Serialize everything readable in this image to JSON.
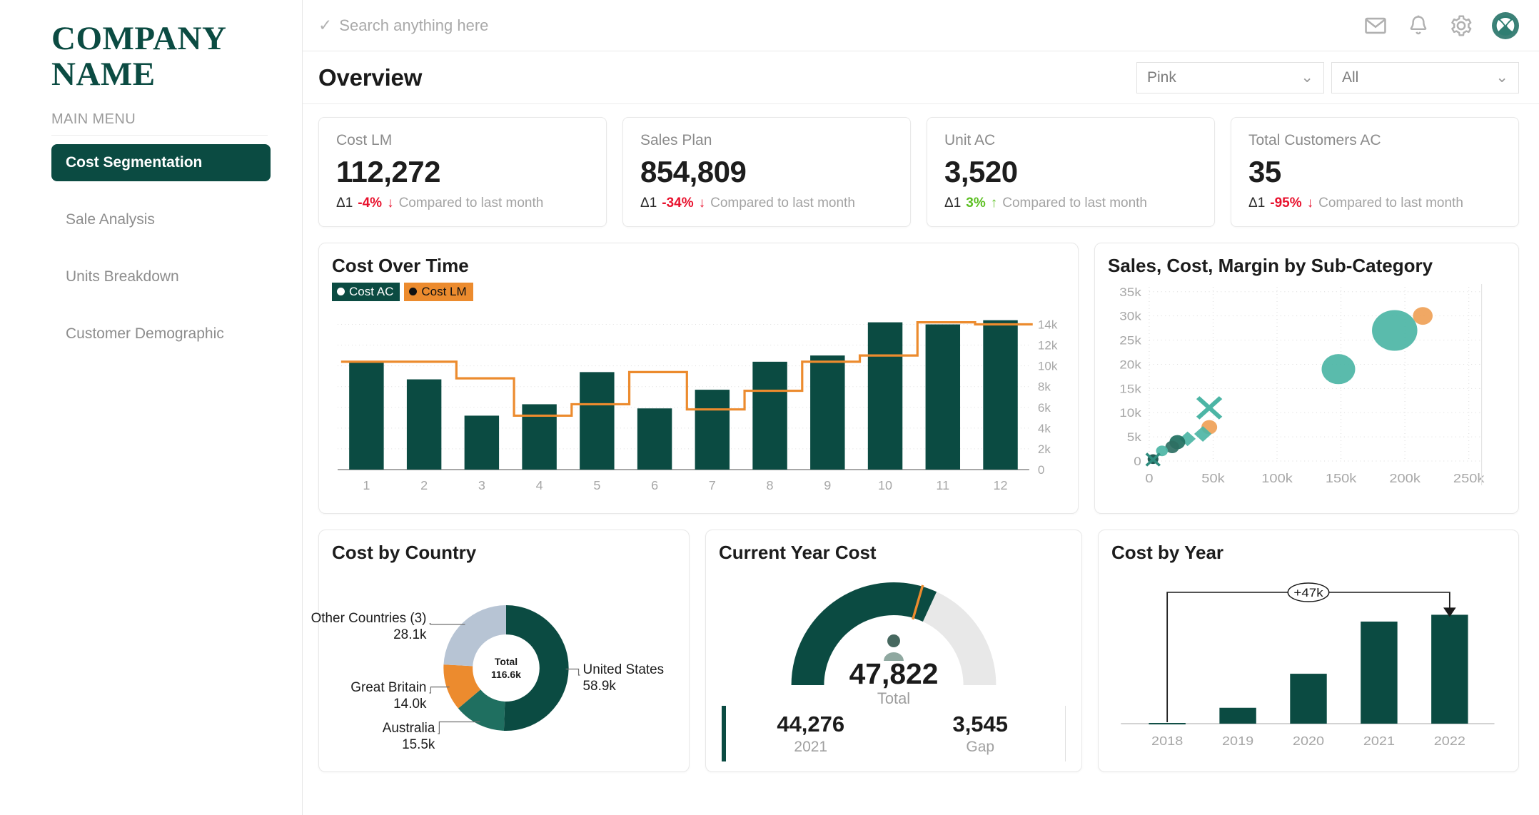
{
  "brand": {
    "name": "COMPANY\nNAME"
  },
  "sidebar": {
    "section_label": "MAIN MENU",
    "items": [
      {
        "label": "Cost Segmentation"
      },
      {
        "label": "Sale Analysis"
      },
      {
        "label": "Units Breakdown"
      },
      {
        "label": "Customer Demographic"
      }
    ]
  },
  "topbar": {
    "search_placeholder": "Search anything here",
    "search_value": "",
    "icons": [
      "mail-icon",
      "bell-icon",
      "gear-icon",
      "avatar"
    ]
  },
  "header": {
    "title": "Overview",
    "filter_color": "Pink",
    "filter_scope": "All",
    "chevron": "⌄"
  },
  "kpis": [
    {
      "title": "Cost LM",
      "value": "112,272",
      "delta_label": "Δ1",
      "pct": "-4%",
      "dir": "down",
      "note": "Compared to last month"
    },
    {
      "title": "Sales Plan",
      "value": "854,809",
      "delta_label": "Δ1",
      "pct": "-34%",
      "dir": "down",
      "note": "Compared to last month"
    },
    {
      "title": "Unit AC",
      "value": "3,520",
      "delta_label": "Δ1",
      "pct": "3%",
      "dir": "up",
      "note": "Compared to last month"
    },
    {
      "title": "Total Customers AC",
      "value": "35",
      "delta_label": "Δ1",
      "pct": "-95%",
      "dir": "down",
      "note": "Compared to last month"
    }
  ],
  "colors": {
    "dark_green": "#0B4B42",
    "orange": "#EC8B2E",
    "teal": "#4CB5A5",
    "mid_green": "#1F6F60",
    "light_blue_grey": "#B7C4D4",
    "red": "#E8112D",
    "green_pos": "#5BBF21",
    "track_grey": "#E8E8E8"
  },
  "chart_data": [
    {
      "id": "cost_over_time",
      "type": "bar",
      "title": "Cost Over Time",
      "legend": [
        "Cost AC",
        "Cost LM"
      ],
      "legend_position": "top-left",
      "categories": [
        "1",
        "2",
        "3",
        "4",
        "5",
        "6",
        "7",
        "8",
        "9",
        "10",
        "11",
        "12"
      ],
      "series": [
        {
          "name": "Cost AC",
          "type": "bar",
          "values": [
            10300,
            8700,
            5200,
            6300,
            9400,
            5900,
            7700,
            10400,
            11000,
            14200,
            14000,
            14400
          ]
        },
        {
          "name": "Cost LM",
          "type": "step",
          "values": [
            10400,
            10400,
            8800,
            5200,
            6300,
            9400,
            5800,
            7600,
            10400,
            11000,
            14200,
            14000
          ]
        }
      ],
      "ylim": [
        0,
        15000
      ],
      "yticks": [
        "0",
        "2k",
        "4k",
        "6k",
        "8k",
        "10k",
        "12k",
        "14k"
      ],
      "ytick_values": [
        0,
        2000,
        4000,
        6000,
        8000,
        10000,
        12000,
        14000
      ],
      "xlabel": "",
      "ylabel": "",
      "grid": true,
      "y_axis_side": "right"
    },
    {
      "id": "sales_cost_margin",
      "type": "scatter",
      "title": "Sales, Cost, Margin by Sub-Category",
      "xlim": [
        0,
        260000
      ],
      "ylim": [
        0,
        36000
      ],
      "xticks": [
        "0",
        "50k",
        "100k",
        "150k",
        "200k",
        "250k"
      ],
      "xtick_values": [
        0,
        50000,
        100000,
        150000,
        200000,
        250000
      ],
      "yticks": [
        "0",
        "5k",
        "10k",
        "15k",
        "20k",
        "25k",
        "30k",
        "35k"
      ],
      "ytick_values": [
        0,
        5000,
        10000,
        15000,
        20000,
        25000,
        30000,
        35000
      ],
      "grid": true,
      "points": [
        {
          "x": 192000,
          "y": 27000,
          "r": 46,
          "color": "#4CB5A5",
          "shape": "circle"
        },
        {
          "x": 214000,
          "y": 30000,
          "r": 20,
          "color": "#EFA157",
          "shape": "circle"
        },
        {
          "x": 148000,
          "y": 19000,
          "r": 34,
          "color": "#4CB5A5",
          "shape": "circle"
        },
        {
          "x": 47000,
          "y": 11000,
          "r": 22,
          "color": "#4CB5A5",
          "shape": "x"
        },
        {
          "x": 47000,
          "y": 7000,
          "r": 16,
          "color": "#EFA157",
          "shape": "circle"
        },
        {
          "x": 42000,
          "y": 5600,
          "r": 16,
          "color": "#4CB5A5",
          "shape": "diamond"
        },
        {
          "x": 30000,
          "y": 4600,
          "r": 15,
          "color": "#4CB5A5",
          "shape": "diamond"
        },
        {
          "x": 22000,
          "y": 3900,
          "r": 16,
          "color": "#1F6F60",
          "shape": "circle"
        },
        {
          "x": 18000,
          "y": 2900,
          "r": 14,
          "color": "#2E6F63",
          "shape": "circle"
        },
        {
          "x": 10000,
          "y": 2100,
          "r": 12,
          "color": "#4CB5A5",
          "shape": "circle"
        },
        {
          "x": 3000,
          "y": 400,
          "r": 11,
          "color": "#0F4F46",
          "shape": "circle"
        },
        {
          "x": 3000,
          "y": 300,
          "r": 13,
          "color": "#2E8C7E",
          "shape": "x"
        }
      ]
    },
    {
      "id": "cost_by_country",
      "type": "pie",
      "title": "Cost by Country",
      "center_label": "Total",
      "center_value": "116.6k",
      "slices": [
        {
          "label": "United States",
          "value_label": "58.9k",
          "value": 58900,
          "color": "#0B4B42"
        },
        {
          "label": "Australia",
          "value_label": "15.5k",
          "value": 15500,
          "color": "#1F6F60"
        },
        {
          "label": "Great Britain",
          "value_label": "14.0k",
          "value": 14000,
          "color": "#EC8B2E"
        },
        {
          "label": "Other Countries (3)",
          "value_label": "28.1k",
          "value": 28100,
          "color": "#B7C4D4"
        }
      ]
    },
    {
      "id": "current_year_cost",
      "type": "gauge",
      "title": "Current Year Cost",
      "value": 47822,
      "value_label": "47,822",
      "value_sub": "Total",
      "target": 44276,
      "max": 75000,
      "footer": [
        {
          "value": "44,276",
          "label": "2021"
        },
        {
          "value": "3,545",
          "label": "Gap"
        }
      ]
    },
    {
      "id": "cost_by_year",
      "type": "bar",
      "title": "Cost by Year",
      "categories": [
        "2018",
        "2019",
        "2020",
        "2021",
        "2022"
      ],
      "values": [
        300,
        7000,
        22000,
        45000,
        48000
      ],
      "ylim": [
        0,
        56000
      ],
      "annotation": "+47k",
      "grid": false
    }
  ]
}
